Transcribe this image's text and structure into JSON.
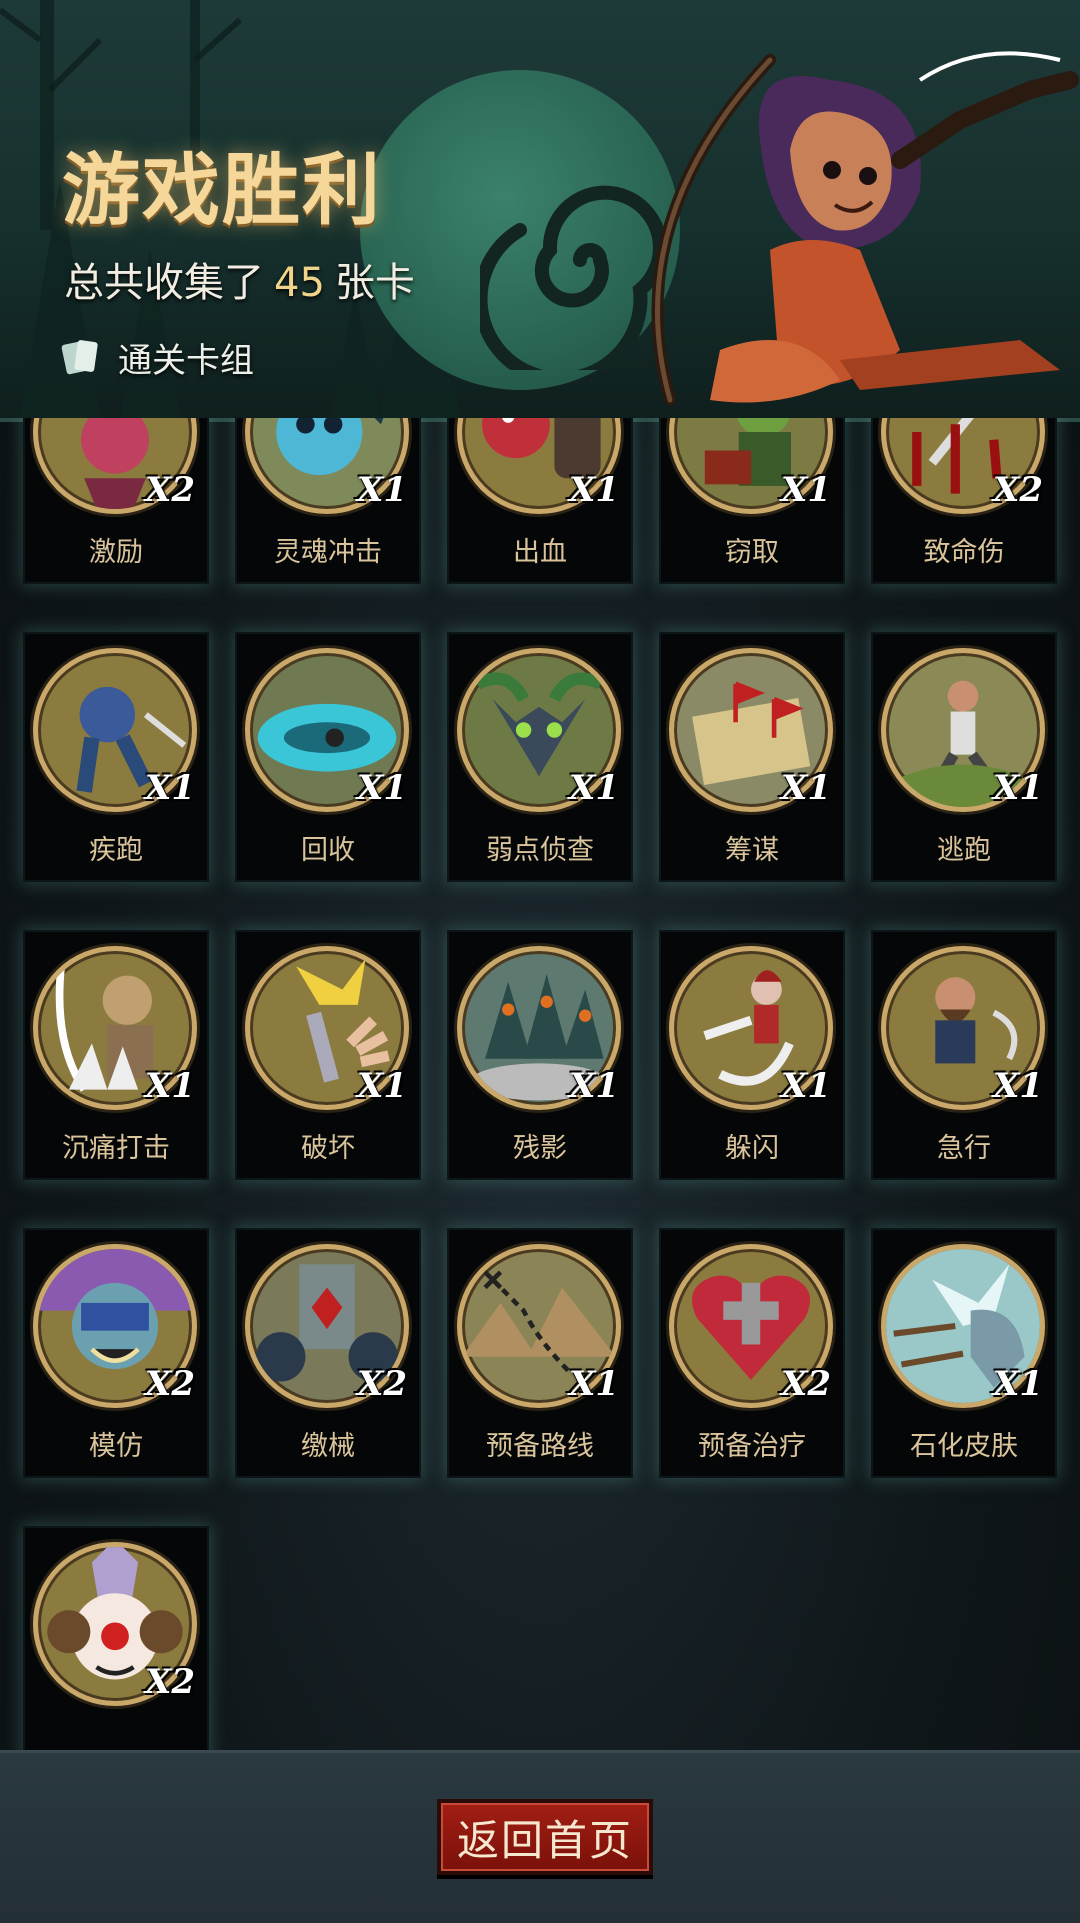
{
  "header": {
    "title": "游戏胜利",
    "collect_prefix": "总共收集了",
    "collect_count": "45",
    "collect_suffix": "张卡",
    "deck_label": "通关卡组"
  },
  "colors": {
    "title_gold": "#f5d79a",
    "card_name": "#d9c49b",
    "card_glow": "#589b8c",
    "button_red": "#a21e14",
    "art_rim": "#c9a86a"
  },
  "cards": [
    {
      "name": "激励",
      "count": "X2",
      "icon": "horned-warrior-icon",
      "bg": "#8b7b3e"
    },
    {
      "name": "灵魂冲击",
      "count": "X1",
      "icon": "blue-skull-spirit-icon",
      "bg": "#7f8a5a"
    },
    {
      "name": "出血",
      "count": "X1",
      "icon": "red-tentacle-monster-icon",
      "bg": "#8b7b3e"
    },
    {
      "name": "窃取",
      "count": "X1",
      "icon": "goblin-thief-icon",
      "bg": "#7d7b44"
    },
    {
      "name": "致命伤",
      "count": "X2",
      "icon": "bloody-dagger-icon",
      "bg": "#8b7b3e"
    },
    {
      "name": "疾跑",
      "count": "X1",
      "icon": "running-werewolf-icon",
      "bg": "#8b7b3e"
    },
    {
      "name": "回收",
      "count": "X1",
      "icon": "spinning-blade-icon",
      "bg": "#6f7a52"
    },
    {
      "name": "弱点侦查",
      "count": "X1",
      "icon": "wolf-head-icon",
      "bg": "#6e7a45"
    },
    {
      "name": "筹谋",
      "count": "X1",
      "icon": "map-flags-icon",
      "bg": "#8b8a66"
    },
    {
      "name": "逃跑",
      "count": "X1",
      "icon": "fleeing-man-icon",
      "bg": "#8b8a56"
    },
    {
      "name": "沉痛打击",
      "count": "X1",
      "icon": "ogre-strike-icon",
      "bg": "#8b7b3e"
    },
    {
      "name": "破坏",
      "count": "X1",
      "icon": "broken-sword-icon",
      "bg": "#8b7b3e"
    },
    {
      "name": "残影",
      "count": "X1",
      "icon": "shadow-clones-icon",
      "bg": "#5e7a70"
    },
    {
      "name": "躲闪",
      "count": "X1",
      "icon": "dodging-girl-icon",
      "bg": "#8b7b3e"
    },
    {
      "name": "急行",
      "count": "X1",
      "icon": "dashing-dwarf-icon",
      "bg": "#8b7b3e"
    },
    {
      "name": "模仿",
      "count": "X2",
      "icon": "masked-troll-icon",
      "bg": "#8b7b3e"
    },
    {
      "name": "缴械",
      "count": "X2",
      "icon": "gear-shield-icon",
      "bg": "#7a7a5a"
    },
    {
      "name": "预备路线",
      "count": "X1",
      "icon": "mountain-route-icon",
      "bg": "#8b8456"
    },
    {
      "name": "预备治疗",
      "count": "X2",
      "icon": "heart-cross-icon",
      "bg": "#8b7b3e"
    },
    {
      "name": "石化皮肤",
      "count": "X1",
      "icon": "stone-fist-icon",
      "bg": "#7a8a74"
    },
    {
      "name": "",
      "count": "X2",
      "icon": "clown-face-icon",
      "bg": "#8b7b3e"
    }
  ],
  "footer": {
    "home_button": "返回首页"
  }
}
